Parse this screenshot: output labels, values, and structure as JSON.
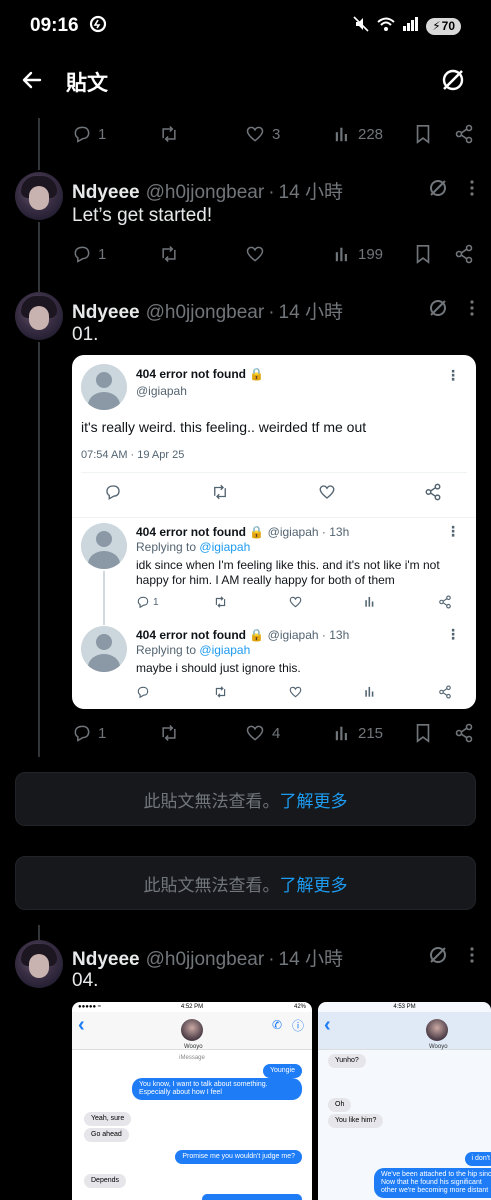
{
  "status_bar": {
    "time": "09:16",
    "battery": "70"
  },
  "nav": {
    "title": "貼文"
  },
  "top_actions": {
    "replies": "1",
    "reposts": "",
    "likes": "3",
    "views": "228"
  },
  "tweets": [
    {
      "name": "Ndyeee",
      "handle": "@h0jjongbear",
      "time": "14 小時",
      "text": "Let’s get started!",
      "replies": "1",
      "reposts": "",
      "likes": "",
      "views": "199"
    },
    {
      "name": "Ndyeee",
      "handle": "@h0jjongbear",
      "time": "14 小時",
      "text": "01.",
      "replies": "1",
      "reposts": "",
      "likes": "4",
      "views": "215"
    },
    {
      "name": "Ndyeee",
      "handle": "@h0jjongbear",
      "time": "14 小時",
      "text": "04."
    }
  ],
  "embed": {
    "main": {
      "name": "404 error not found",
      "handle": "@igiapah",
      "text": "it's really weird. this feeling.. weirded tf me out",
      "date": "07:54 AM · 19 Apr 25"
    },
    "replies": [
      {
        "name": "404 error not found",
        "handle": "@igiapah",
        "time": "13h",
        "replying_prefix": "Replying to",
        "replying_to": "@igiapah",
        "text": "idk since when I'm feeling like this. and it's not like i'm not happy for him. I AM really happy for both of them",
        "reply_count": "1"
      },
      {
        "name": "404 error not found",
        "handle": "@igiapah",
        "time": "13h",
        "replying_prefix": "Replying to",
        "replying_to": "@igiapah",
        "text": "maybe i should just ignore this."
      }
    ]
  },
  "notices": [
    {
      "text": "此貼文無法查看。",
      "link": "了解更多"
    },
    {
      "text": "此貼文無法查看。",
      "link": "了解更多"
    }
  ],
  "shots": {
    "left": {
      "time": "4:52 PM",
      "battery": "42%",
      "contact": "Wooyo",
      "label": "iMessage",
      "bubbles": [
        "Youngie",
        "You know, I want to talk about something. Especially about how I feel",
        "Yeah, sure",
        "Go ahead",
        "Promise me you wouldn't judge me?",
        "Depends"
      ]
    },
    "right": {
      "time": "4:53 PM",
      "contact": "Wooyo",
      "bubbles": [
        "Yunho?",
        "Oh",
        "You like him?",
        "i don't",
        "We've been attached to the hip since Now that he found his significant other we're becoming more distant"
      ]
    }
  },
  "colors": {
    "accent": "#1d9bf0",
    "background": "#000000",
    "muted": "#71767b"
  }
}
